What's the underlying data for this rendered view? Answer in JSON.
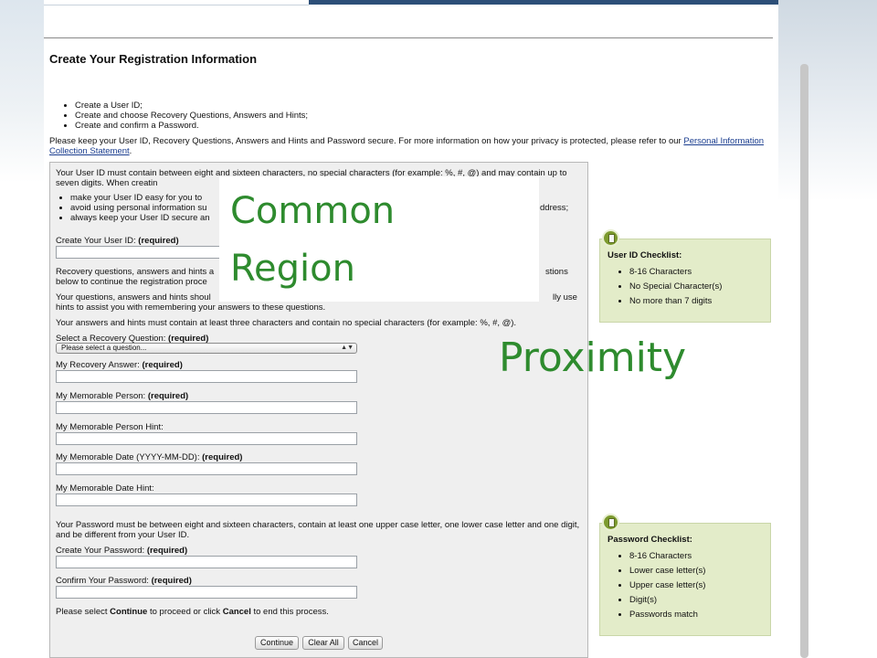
{
  "page_title": "Create Your Registration Information",
  "intro_items": [
    "Create a User ID;",
    "Create and choose Recovery Questions, Answers and Hints;",
    "Create and confirm a Password."
  ],
  "privacy": {
    "text": "Please keep your User ID, Recovery Questions, Answers and Hints and Password secure. For more information on how your privacy is protected, please refer to our",
    "link_text": "Personal Information Collection Statement",
    "end": "."
  },
  "form": {
    "userid_intro": "Your User ID must contain between eight and sixteen characters, no special characters (for example: %, #, @) and may contain up to seven digits. When creatin",
    "rules": [
      "make your User ID easy for you to",
      "avoid using personal information su",
      "always keep your User ID secure an"
    ],
    "rule_tail": "ddress;",
    "userid_label": "Create Your User ID:",
    "required": "(required)",
    "recovery_intro_a": "Recovery questions, answers and hints a",
    "recovery_intro_a_tail": "stions",
    "recovery_intro_b": "below to continue the registration proce",
    "recovery_memorable_a": "Your questions, answers and hints shoul",
    "recovery_memorable_a_tail": "lly use",
    "recovery_memorable_b": "hints to assist you with remembering your answers to these questions.",
    "answers_rule": "Your answers and hints must contain at least three characters and contain no special characters (for example: %, #, @).",
    "question_label": "Select a Recovery Question:",
    "question_placeholder": "Please select a question...",
    "answer_label": "My Recovery Answer:",
    "person_label": "My Memorable Person:",
    "person_hint_label": "My Memorable Person Hint:",
    "date_label": "My Memorable Date (YYYY-MM-DD):",
    "date_hint_label": "My Memorable Date Hint:",
    "password_rule": "Your Password must be between eight and sixteen characters, contain at least one upper case letter, one lower case letter and one digit, and be different from your User ID.",
    "password_label": "Create Your Password:",
    "confirm_label": "Confirm Your Password:",
    "proceed_a": "Please select",
    "proceed_continue": "Continue",
    "proceed_b": "to proceed or click",
    "proceed_cancel": "Cancel",
    "proceed_c": "to end this process.",
    "btn_continue": "Continue",
    "btn_clear": "Clear All",
    "btn_cancel": "Cancel"
  },
  "overlay": {
    "common_line1": "Common",
    "common_line2": "Region",
    "proximity": "Proximity",
    "color": "#2e8b2e"
  },
  "userid_checklist": {
    "title": "User ID Checklist:",
    "items": [
      "8-16 Characters",
      "No Special Character(s)",
      "No more than 7 digits"
    ]
  },
  "password_checklist": {
    "title": "Password Checklist:",
    "items": [
      "8-16 Characters",
      "Lower case letter(s)",
      "Upper case letter(s)",
      "Digit(s)",
      "Passwords match"
    ]
  },
  "icons": {
    "checklist": "clipboard-icon"
  }
}
